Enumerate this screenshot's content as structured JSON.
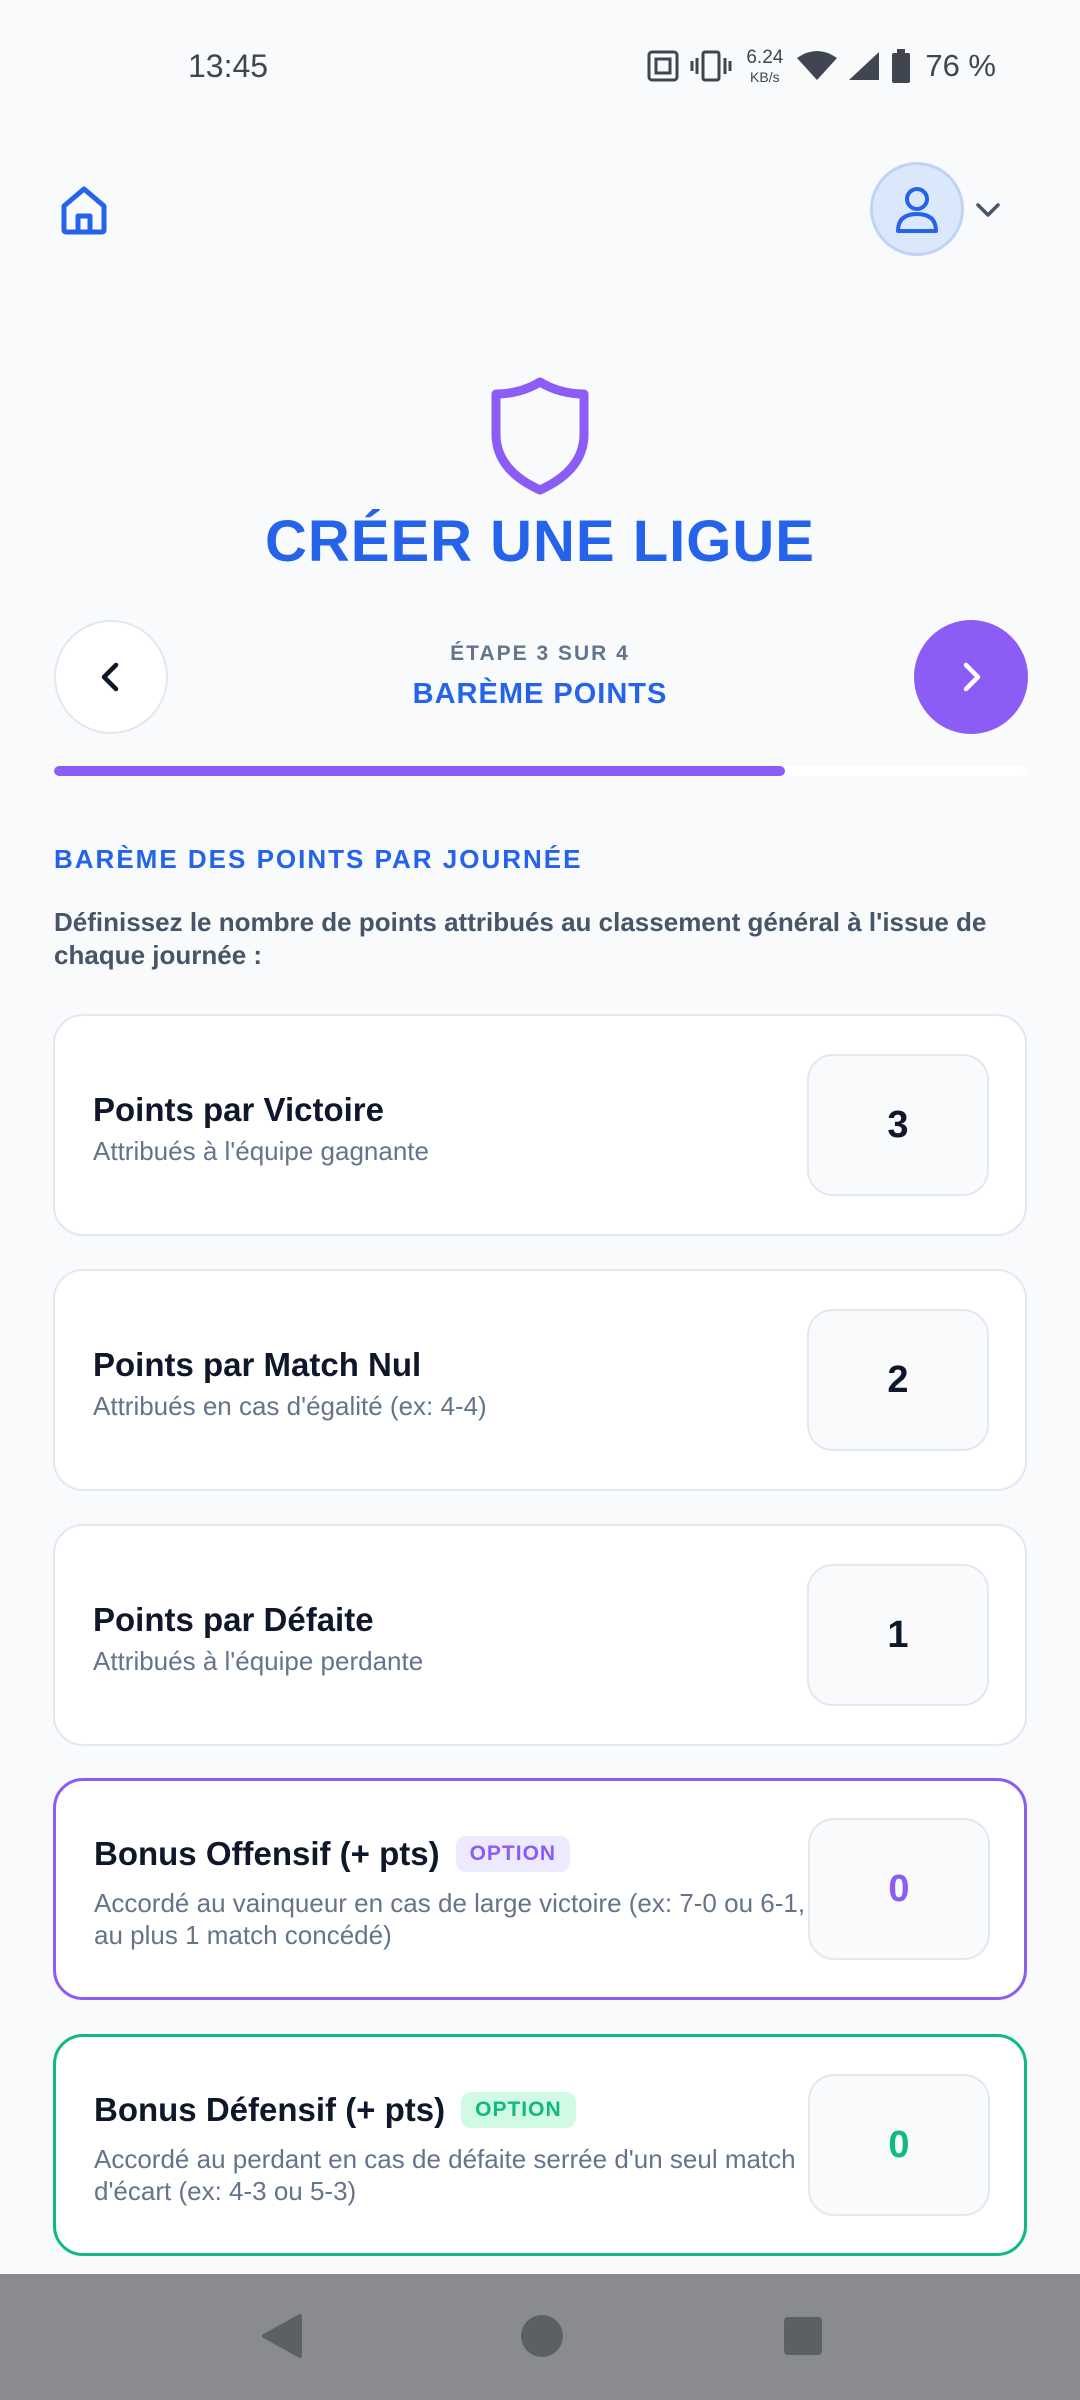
{
  "status": {
    "time": "13:45",
    "speed_value": "6.24",
    "speed_unit": "KB/s",
    "battery": "76 %"
  },
  "header": {
    "title": "CRÉER UNE LIGUE"
  },
  "stepper": {
    "step_label": "ÉTAPE 3 SUR 4",
    "step_name": "BARÈME POINTS",
    "progress_fraction": 0.75
  },
  "section": {
    "title": "BARÈME DES POINTS PAR JOURNÉE",
    "description": "Définissez le nombre de points attribués au classement général à l'issue de chaque journée :"
  },
  "rows": [
    {
      "title": "Points par Victoire",
      "subtitle": "Attribués à l'équipe gagnante",
      "value": "3"
    },
    {
      "title": "Points par Match Nul",
      "subtitle": "Attribués en cas d'égalité (ex: 4-4)",
      "value": "2"
    },
    {
      "title": "Points par Défaite",
      "subtitle": "Attribués à l'équipe perdante",
      "value": "1"
    },
    {
      "title": "Bonus Offensif (+ pts)",
      "badge": "OPTION",
      "subtitle": "Accordé au vainqueur en cas de large victoire (ex: 7-0 ou 6-1, au plus 1 match concédé)",
      "value": "0"
    },
    {
      "title": "Bonus Défensif (+ pts)",
      "badge": "OPTION",
      "subtitle": "Accordé au perdant en cas de défaite serrée d'un seul match d'écart (ex: 4-3 ou 5-3)",
      "value": "0"
    }
  ],
  "colors": {
    "primary_blue": "#2563eb",
    "accent_purple": "#8b5cf6",
    "accent_green": "#10b981"
  },
  "icons": {
    "home": "home-icon",
    "user": "user-icon",
    "shield": "shield-icon",
    "back": "chevron-left-icon",
    "next": "chevron-right-icon"
  }
}
